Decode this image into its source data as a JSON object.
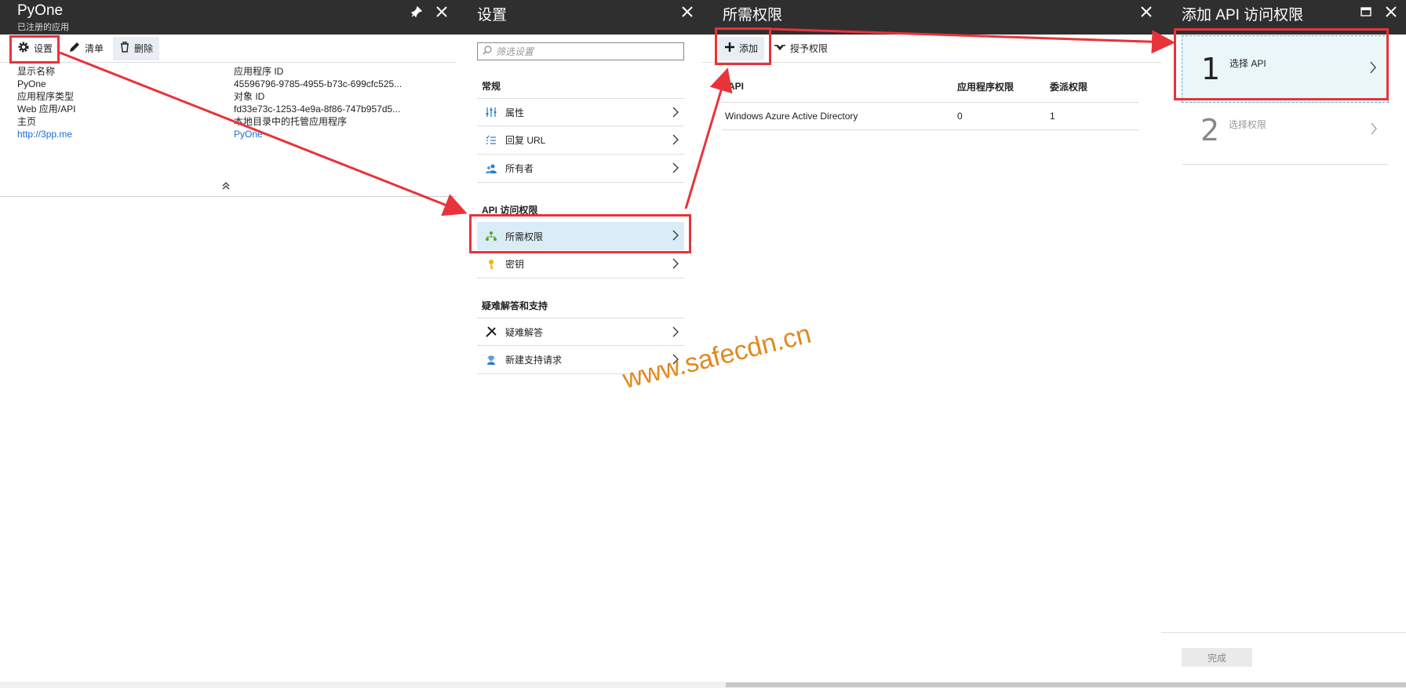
{
  "blade1": {
    "title": "PyOne",
    "subtitle": "已注册的应用",
    "toolbar": {
      "settings": "设置",
      "manifest": "清单",
      "delete": "删除"
    },
    "essentials": {
      "display_name_label": "显示名称",
      "display_name": "PyOne",
      "app_type_label": "应用程序类型",
      "app_type": "Web 应用/API",
      "home_label": "主页",
      "home": "http://3pp.me",
      "app_id_label": "应用程序 ID",
      "app_id": "45596796-9785-4955-b73c-699cfc525...",
      "object_id_label": "对象 ID",
      "object_id": "fd33e73c-1253-4e9a-8f86-747b957d5...",
      "managed_label": "本地目录中的托管应用程序",
      "managed": "PyOne"
    }
  },
  "blade2": {
    "title": "设置",
    "filter_placeholder": "筛选设置",
    "sections": [
      {
        "heading": "常规",
        "items": [
          "属性",
          "回复 URL",
          "所有者"
        ]
      },
      {
        "heading": "API 访问权限",
        "items": [
          "所需权限",
          "密钥"
        ]
      },
      {
        "heading": "疑难解答和支持",
        "items": [
          "疑难解答",
          "新建支持请求"
        ]
      }
    ]
  },
  "blade3": {
    "title": "所需权限",
    "toolbar": {
      "add": "添加",
      "grant": "授予权限"
    },
    "columns": [
      "API",
      "应用程序权限",
      "委派权限"
    ],
    "rows": [
      [
        "Windows Azure Active Directory",
        "0",
        "1"
      ]
    ]
  },
  "blade4": {
    "title": "添加 API 访问权限",
    "steps": [
      {
        "num": "1",
        "label": "选择 API"
      },
      {
        "num": "2",
        "label": "选择权限"
      }
    ],
    "done": "完成"
  },
  "watermark": "www.safecdn.cn",
  "colors": {
    "header": "#2f2f2f",
    "highlight": "#e8333a",
    "accent": "#1a6fd0",
    "active": "#d9ecf8"
  }
}
